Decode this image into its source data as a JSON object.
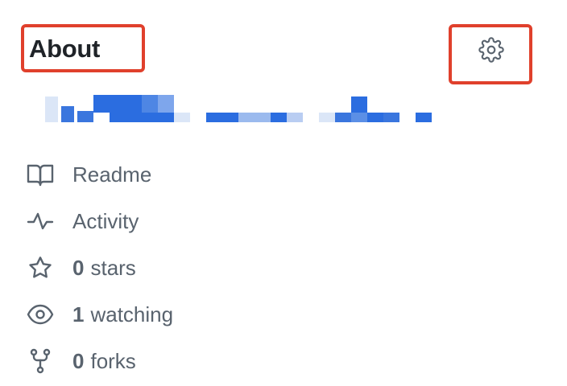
{
  "about": {
    "title": "About"
  },
  "settings": {
    "icon": "gear-icon"
  },
  "description": {
    "redacted": true
  },
  "meta": {
    "readme": {
      "label": "Readme",
      "icon": "book-icon"
    },
    "activity": {
      "label": "Activity",
      "icon": "pulse-icon"
    },
    "stars": {
      "count": "0",
      "label": "stars",
      "icon": "star-icon"
    },
    "watching": {
      "count": "1",
      "label": "watching",
      "icon": "eye-icon"
    },
    "forks": {
      "count": "0",
      "label": "forks",
      "icon": "fork-icon"
    }
  },
  "colors": {
    "highlight": "#e0402c",
    "text_primary": "#1f2328",
    "text_muted": "#59636e",
    "link_blue": "#2b6de0"
  }
}
